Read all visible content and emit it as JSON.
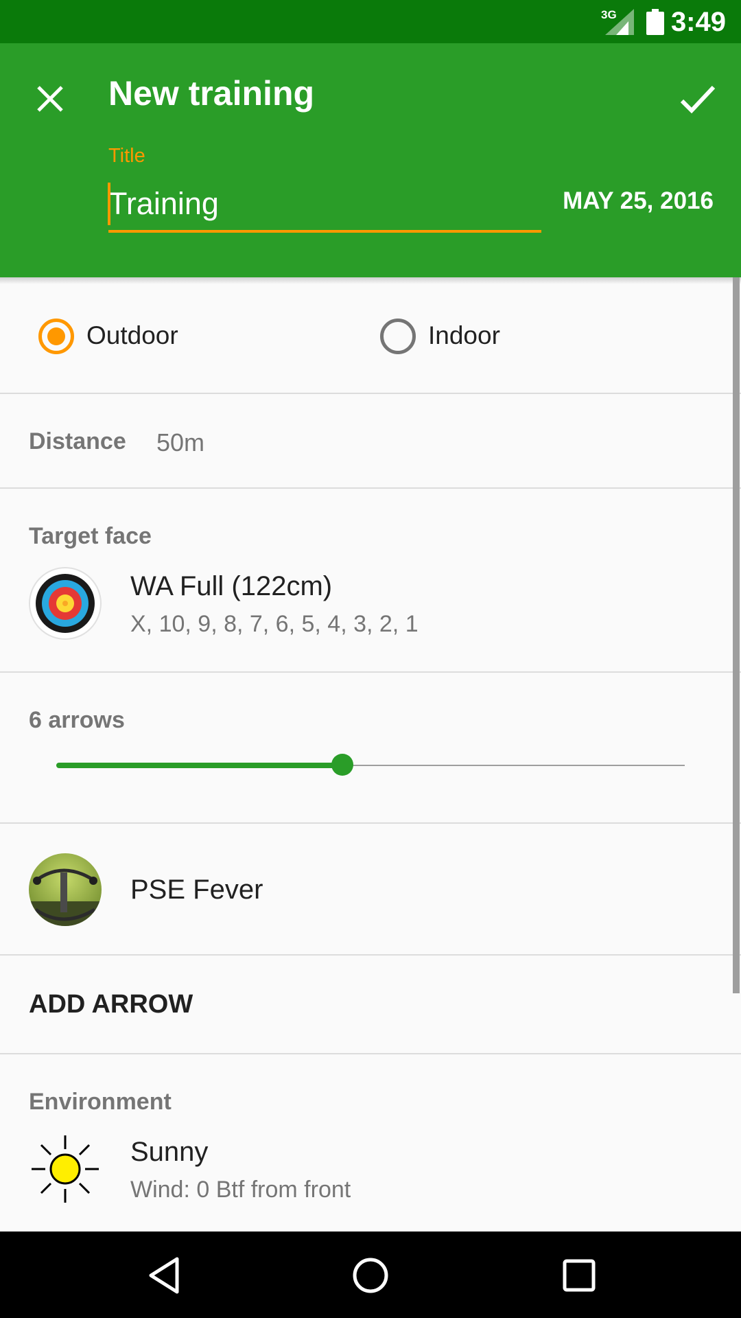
{
  "status_bar": {
    "network": "3G",
    "time": "3:49"
  },
  "app_bar": {
    "title": "New training",
    "title_field_label": "Title",
    "title_field_value": "Training",
    "date": "MAY 25, 2016"
  },
  "location": {
    "options": [
      {
        "label": "Outdoor",
        "selected": true
      },
      {
        "label": "Indoor",
        "selected": false
      }
    ]
  },
  "distance": {
    "label": "Distance",
    "value": "50m"
  },
  "target_face": {
    "label": "Target face",
    "name": "WA Full (122cm)",
    "scoring": "X, 10, 9, 8, 7, 6, 5, 4, 3, 2, 1"
  },
  "arrows": {
    "label": "6 arrows",
    "value": 6,
    "slider_fraction": 0.455
  },
  "bow": {
    "name": "PSE Fever"
  },
  "add_arrow": {
    "label": "ADD ARROW"
  },
  "environment": {
    "label": "Environment",
    "weather": "Sunny",
    "wind": "Wind: 0 Btf from front"
  },
  "colors": {
    "primary": "#2a9d28",
    "primary_dark": "#0a7a0a",
    "accent": "#ff9800"
  }
}
